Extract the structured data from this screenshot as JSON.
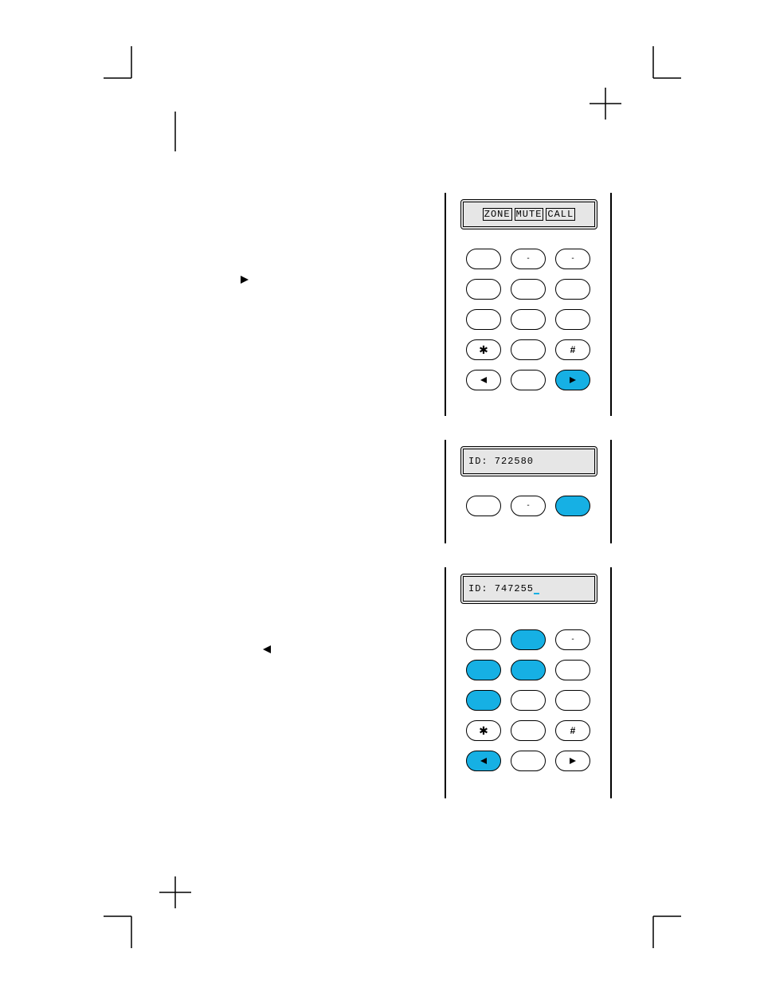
{
  "panel1": {
    "lcd_items": [
      "ZONE",
      "MUTE",
      "CALL"
    ],
    "keys": [
      {
        "label": "",
        "blue": false
      },
      {
        "label": "-",
        "blue": false
      },
      {
        "label": "-",
        "blue": false
      },
      {
        "label": "",
        "blue": false
      },
      {
        "label": "",
        "blue": false
      },
      {
        "label": "",
        "blue": false
      },
      {
        "label": "",
        "blue": false
      },
      {
        "label": "",
        "blue": false
      },
      {
        "label": "",
        "blue": false
      },
      {
        "label": "*",
        "blue": false
      },
      {
        "label": "",
        "blue": false
      },
      {
        "label": "#",
        "blue": false
      },
      {
        "label": "◄",
        "blue": false
      },
      {
        "label": "",
        "blue": false
      },
      {
        "label": "►",
        "blue": true
      }
    ]
  },
  "panel2": {
    "lcd_text": "ID: 722580",
    "keys": [
      {
        "label": "",
        "blue": false
      },
      {
        "label": "-",
        "blue": false
      },
      {
        "label": "",
        "blue": true
      }
    ]
  },
  "panel3": {
    "lcd_text": "ID: 747255",
    "show_cursor": true,
    "keys": [
      {
        "label": "",
        "blue": false
      },
      {
        "label": "",
        "blue": true
      },
      {
        "label": "-",
        "blue": false
      },
      {
        "label": "",
        "blue": true
      },
      {
        "label": "",
        "blue": true
      },
      {
        "label": "",
        "blue": false
      },
      {
        "label": "",
        "blue": true
      },
      {
        "label": "",
        "blue": false
      },
      {
        "label": "",
        "blue": false
      },
      {
        "label": "*",
        "blue": false
      },
      {
        "label": "",
        "blue": false
      },
      {
        "label": "#",
        "blue": false
      },
      {
        "label": "◄",
        "blue": true
      },
      {
        "label": "",
        "blue": false
      },
      {
        "label": "►",
        "blue": false
      }
    ]
  }
}
